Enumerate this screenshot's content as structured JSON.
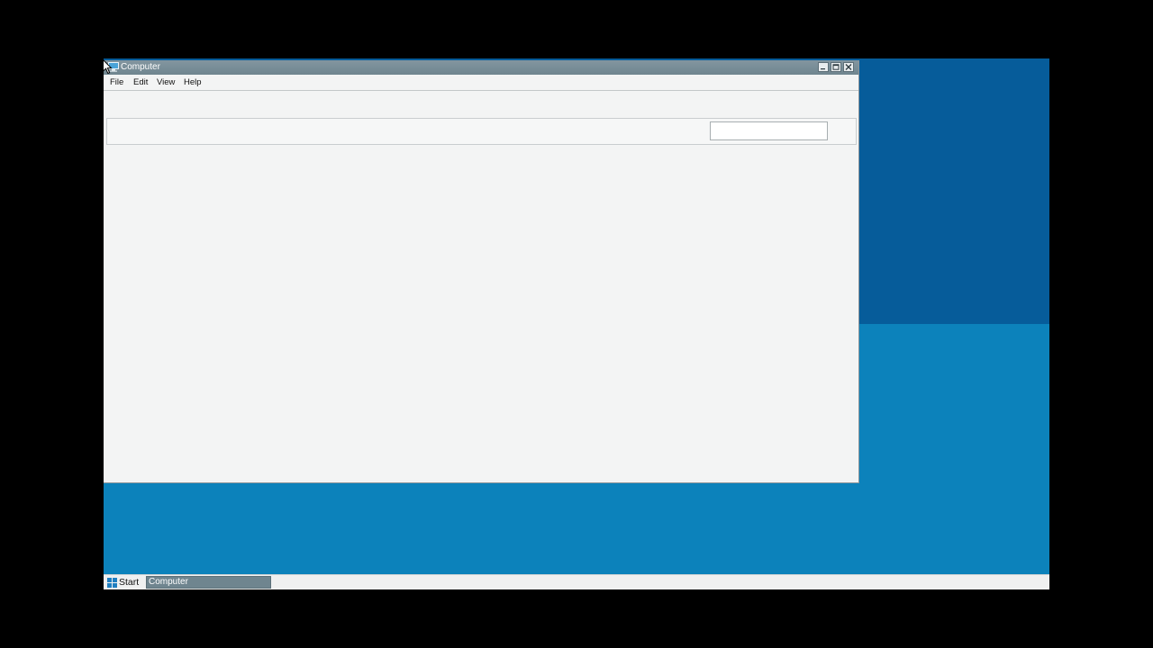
{
  "window": {
    "title": "Computer",
    "icon": "computer-icon",
    "controls": {
      "minimize": "minimize-icon",
      "maximize": "maximize-icon",
      "close": "close-icon"
    }
  },
  "menubar": {
    "items": [
      {
        "label": "File"
      },
      {
        "label": "Edit"
      },
      {
        "label": "View"
      },
      {
        "label": "Help"
      }
    ]
  },
  "search": {
    "value": "",
    "placeholder": ""
  },
  "taskbar": {
    "start_label": "Start",
    "start_icon": "windows-logo-icon",
    "items": [
      {
        "label": "Computer"
      }
    ]
  },
  "colors": {
    "desktop_top": "#065c9a",
    "desktop_bottom": "#0c82bb",
    "titlebar": "#6f858f",
    "window_bg": "#f3f4f4",
    "taskbar_bg": "#eff0f0",
    "taskbar_active_item": "#6f858f"
  }
}
